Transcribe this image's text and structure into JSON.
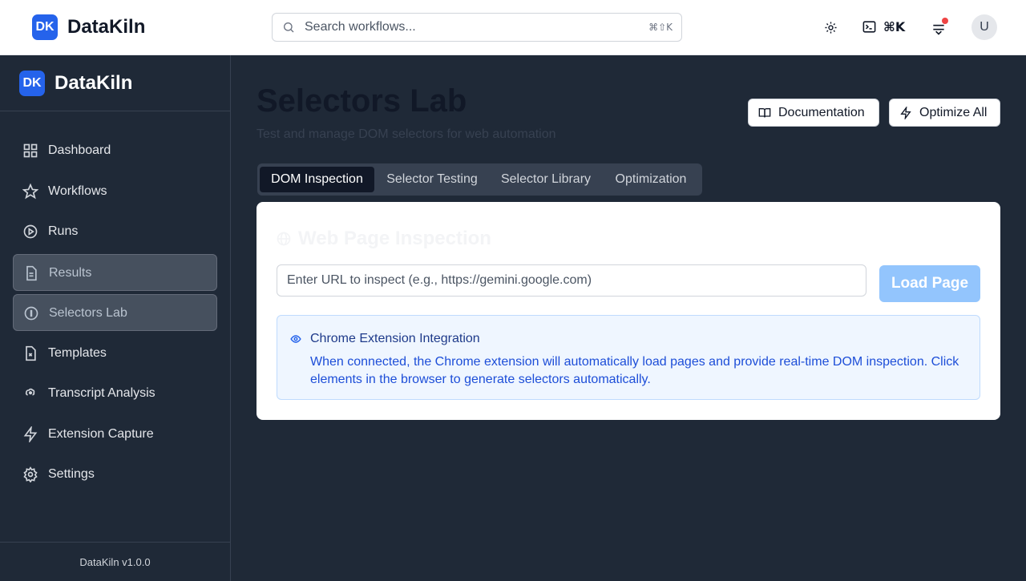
{
  "app": {
    "logo_initials": "DK",
    "name": "DataKiln"
  },
  "topbar": {
    "search_placeholder": "Search workflows...",
    "search_shortcut": "⌘⇧K",
    "command_shortcut": "⌘K",
    "avatar_initial": "U",
    "icons": [
      "search-icon",
      "sun-icon",
      "terminal-icon",
      "notifications-icon"
    ]
  },
  "sidebar": {
    "items": [
      {
        "label": "Dashboard",
        "icon": "dashboard-icon",
        "active": false
      },
      {
        "label": "Workflows",
        "icon": "star-icon",
        "active": false
      },
      {
        "label": "Runs",
        "icon": "play-circle-icon",
        "active": false
      },
      {
        "label": "Results",
        "icon": "file-text-icon",
        "active": true
      },
      {
        "label": "Selectors Lab",
        "icon": "info-circle-icon",
        "active": true
      },
      {
        "label": "Templates",
        "icon": "file-x-icon",
        "active": false
      },
      {
        "label": "Transcript Analysis",
        "icon": "brain-icon",
        "active": false
      },
      {
        "label": "Extension Capture",
        "icon": "zap-icon",
        "active": false
      },
      {
        "label": "Settings",
        "icon": "gear-icon",
        "active": false
      }
    ],
    "version": "DataKiln v1.0.0"
  },
  "main": {
    "title": "Selectors Lab",
    "subtitle": "Test and manage DOM selectors for web automation",
    "actions": {
      "documentation": "Documentation",
      "optimize_all": "Optimize All"
    },
    "tabs": [
      {
        "label": "DOM Inspection",
        "active": true
      },
      {
        "label": "Selector Testing",
        "active": false
      },
      {
        "label": "Selector Library",
        "active": false
      },
      {
        "label": "Optimization",
        "active": false
      }
    ],
    "card": {
      "title": "Web Page Inspection",
      "url_placeholder": "Enter URL to inspect (e.g., https://gemini.google.com)",
      "load_button": "Load Page",
      "info_title": "Chrome Extension Integration",
      "info_text": "When connected, the Chrome extension will automatically load pages and provide real-time DOM inspection. Click elements in the browser to generate selectors automatically."
    }
  },
  "colors": {
    "accent": "#2563eb",
    "sidebar_bg": "#1f2937",
    "notification_dot": "#ef4444"
  }
}
